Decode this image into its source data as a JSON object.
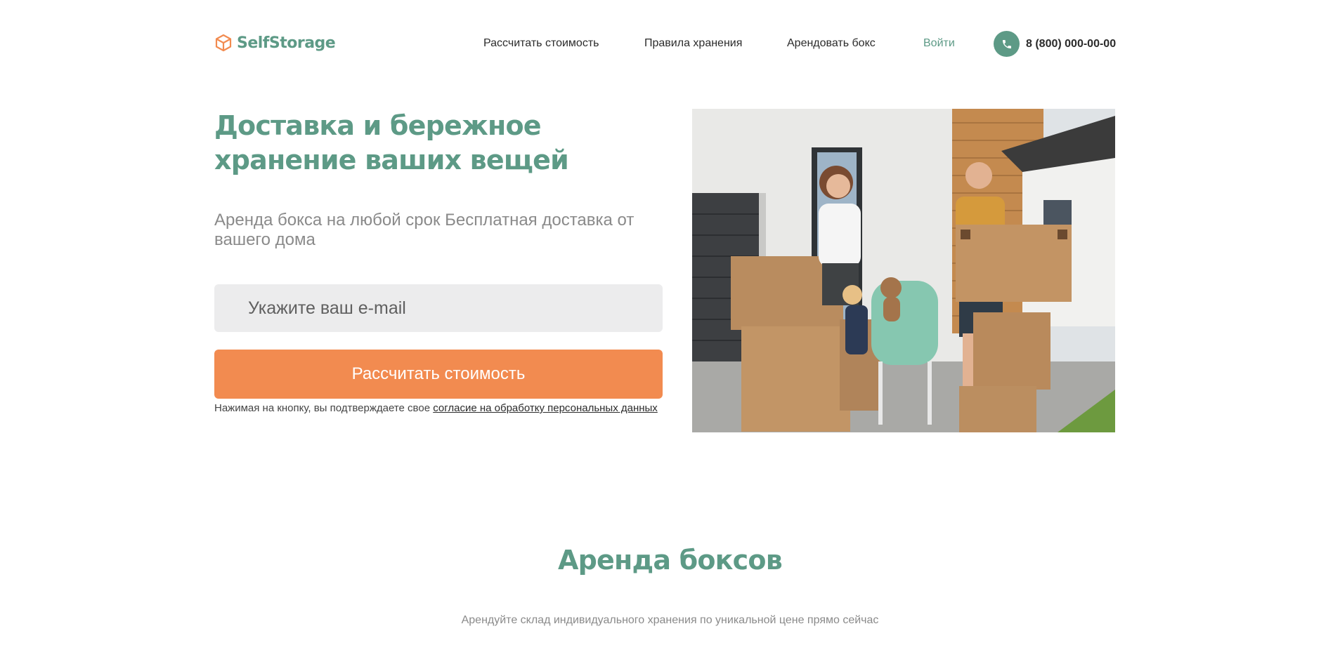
{
  "header": {
    "logo": {
      "text": "SelfStorage",
      "icon": "box-icon"
    },
    "nav": [
      {
        "label": "Рассчитать стоимость"
      },
      {
        "label": "Правила хранения"
      },
      {
        "label": "Арендовать бокс"
      },
      {
        "label": "Войти",
        "active": true
      }
    ],
    "phone": {
      "icon": "phone-icon",
      "number": "8 (800) 000-00-00"
    }
  },
  "hero": {
    "title": "Доставка и бережное хранение ваших вещей",
    "subtitle": "Аренда бокса на любой срок Бесплатная доставка от вашего дома",
    "email": {
      "placeholder": "Укажите ваш e-mail",
      "value": ""
    },
    "button_label": "Рассчитать стоимость",
    "consent": {
      "text": "Нажимая на кнопку, вы подтверждаете свое ",
      "link": "согласие на обработку персональных данных"
    },
    "photo": {
      "icon": "family-moving-boxes-photo"
    }
  },
  "section": {
    "title": "Аренда боксов",
    "subtitle": "Арендуйте склад индивидуального хранения по уникальной цене прямо сейчас"
  },
  "colors": {
    "brand_green": "#5d9a86",
    "accent_orange": "#f28b50",
    "input_bg": "#ececed",
    "muted_text": "#8a8a8a"
  }
}
